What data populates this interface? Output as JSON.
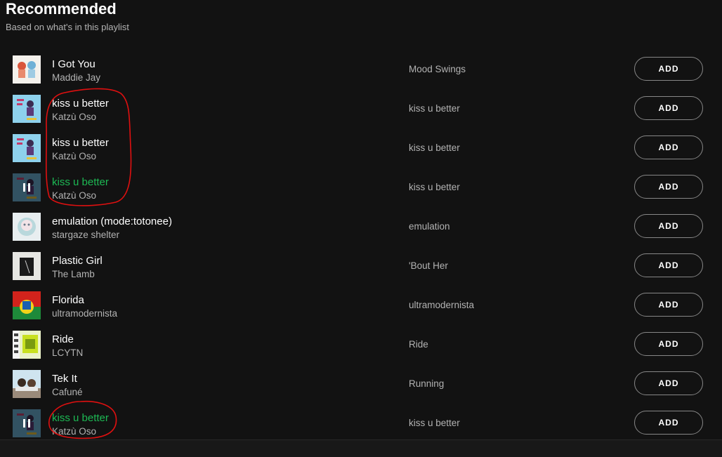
{
  "header": {
    "title": "Recommended",
    "subtitle": "Based on what's in this playlist"
  },
  "colors": {
    "background": "#121212",
    "playing_accent": "#1db954",
    "annotation": "#e01010"
  },
  "tracks": [
    {
      "title": "I Got You",
      "artist": "Maddie Jay",
      "album": "Mood Swings",
      "add_label": "ADD",
      "playing": false,
      "cover": "maddie-jay-cover"
    },
    {
      "title": "kiss u better",
      "artist": "Katzù Oso",
      "album": "kiss u better",
      "add_label": "ADD",
      "playing": false,
      "cover": "katzu-oso-cover"
    },
    {
      "title": "kiss u better",
      "artist": "Katzù Oso",
      "album": "kiss u better",
      "add_label": "ADD",
      "playing": false,
      "cover": "katzu-oso-cover"
    },
    {
      "title": "kiss u better",
      "artist": "Katzù Oso",
      "album": "kiss u better",
      "add_label": "ADD",
      "playing": true,
      "cover": "katzu-oso-cover"
    },
    {
      "title": "emulation (mode:totonee)",
      "artist": "stargaze shelter",
      "album": "emulation",
      "add_label": "ADD",
      "playing": false,
      "cover": "stargaze-cover"
    },
    {
      "title": "Plastic Girl",
      "artist": "The Lamb",
      "album": "'Bout Her",
      "add_label": "ADD",
      "playing": false,
      "cover": "the-lamb-cover"
    },
    {
      "title": "Florida",
      "artist": "ultramodernista",
      "album": "ultramodernista",
      "add_label": "ADD",
      "playing": false,
      "cover": "ultramodernista-cover"
    },
    {
      "title": "Ride",
      "artist": "LCYTN",
      "album": "Ride",
      "add_label": "ADD",
      "playing": false,
      "cover": "lcytn-cover"
    },
    {
      "title": "Tek It",
      "artist": "Cafuné",
      "album": "Running",
      "add_label": "ADD",
      "playing": false,
      "cover": "cafune-cover"
    },
    {
      "title": "kiss u better",
      "artist": "Katzù Oso",
      "album": "kiss u better",
      "add_label": "ADD",
      "playing": true,
      "cover": "katzu-oso-cover"
    }
  ]
}
